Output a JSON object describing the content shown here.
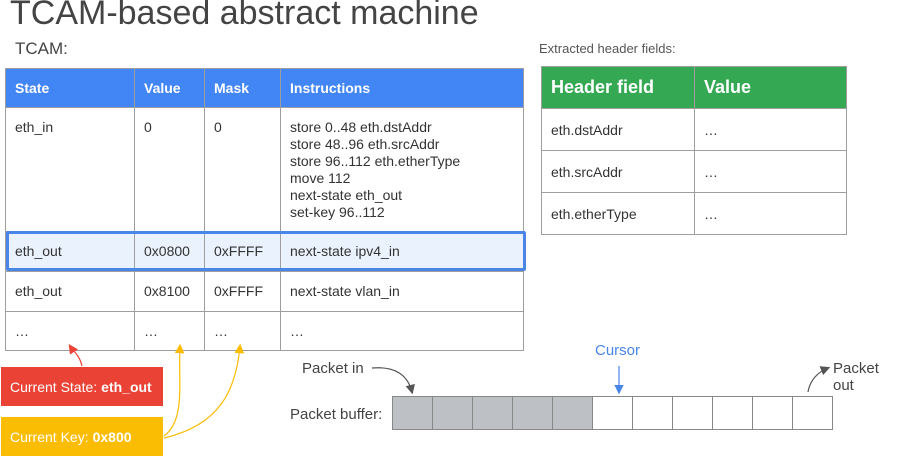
{
  "title": "TCAM-based abstract machine",
  "tcam_label": "TCAM:",
  "extracted_label": "Extracted header fields:",
  "tcam_table": {
    "headers": [
      "State",
      "Value",
      "Mask",
      "Instructions"
    ],
    "rows": [
      {
        "state": "eth_in",
        "value": "0",
        "mask": "0",
        "instructions": [
          "store 0..48 eth.dstAddr",
          "store 48..96 eth.srcAddr",
          "store 96..112 eth.etherType",
          "move 112",
          "next-state eth_out",
          "set-key 96..112"
        ]
      },
      {
        "state": "eth_out",
        "value": "0x0800",
        "mask": "0xFFFF",
        "instructions": [
          "next-state ipv4_in"
        ]
      },
      {
        "state": "eth_out",
        "value": "0x8100",
        "mask": "0xFFFF",
        "instructions": [
          "next-state vlan_in"
        ]
      },
      {
        "state": "…",
        "value": "…",
        "mask": "…",
        "instructions": [
          "…"
        ]
      }
    ]
  },
  "header_table": {
    "headers": [
      "Header field",
      "Value"
    ],
    "rows": [
      {
        "field": "eth.dstAddr",
        "value": "…"
      },
      {
        "field": "eth.srcAddr",
        "value": "…"
      },
      {
        "field": "eth.etherType",
        "value": "…"
      }
    ]
  },
  "current_state": {
    "label": "Current State:",
    "value": "eth_out"
  },
  "current_key": {
    "label": "Current Key:",
    "value": "0x800"
  },
  "packet": {
    "in_label": "Packet in",
    "out_label": "Packet out",
    "cursor_label": "Cursor",
    "buffer_label": "Packet buffer:",
    "filled_cells": 5,
    "total_cells": 11
  },
  "colors": {
    "tcam_header": "#4285f4",
    "header_table_header": "#34a853",
    "state_box": "#ea4335",
    "key_box": "#fbbc04",
    "cursor": "#4a86e8",
    "highlight": "#4a86e8"
  }
}
